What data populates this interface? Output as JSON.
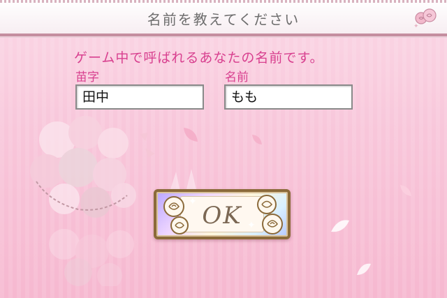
{
  "header": {
    "title": "名前を教えてください",
    "icon": "rose-icon"
  },
  "form": {
    "instruction": "ゲーム中で呼ばれるあなたの名前です。",
    "last_name_label": "苗字",
    "last_name_value": "田中",
    "first_name_label": "名前",
    "first_name_value": "もも"
  },
  "ok_button": {
    "label": "OK",
    "icon": "rose-icon"
  },
  "colors": {
    "accent_text": "#d8408f",
    "header_text": "#6d6d6d",
    "background_pink": "#f8c6da",
    "button_frame": "#8b6a3a"
  }
}
